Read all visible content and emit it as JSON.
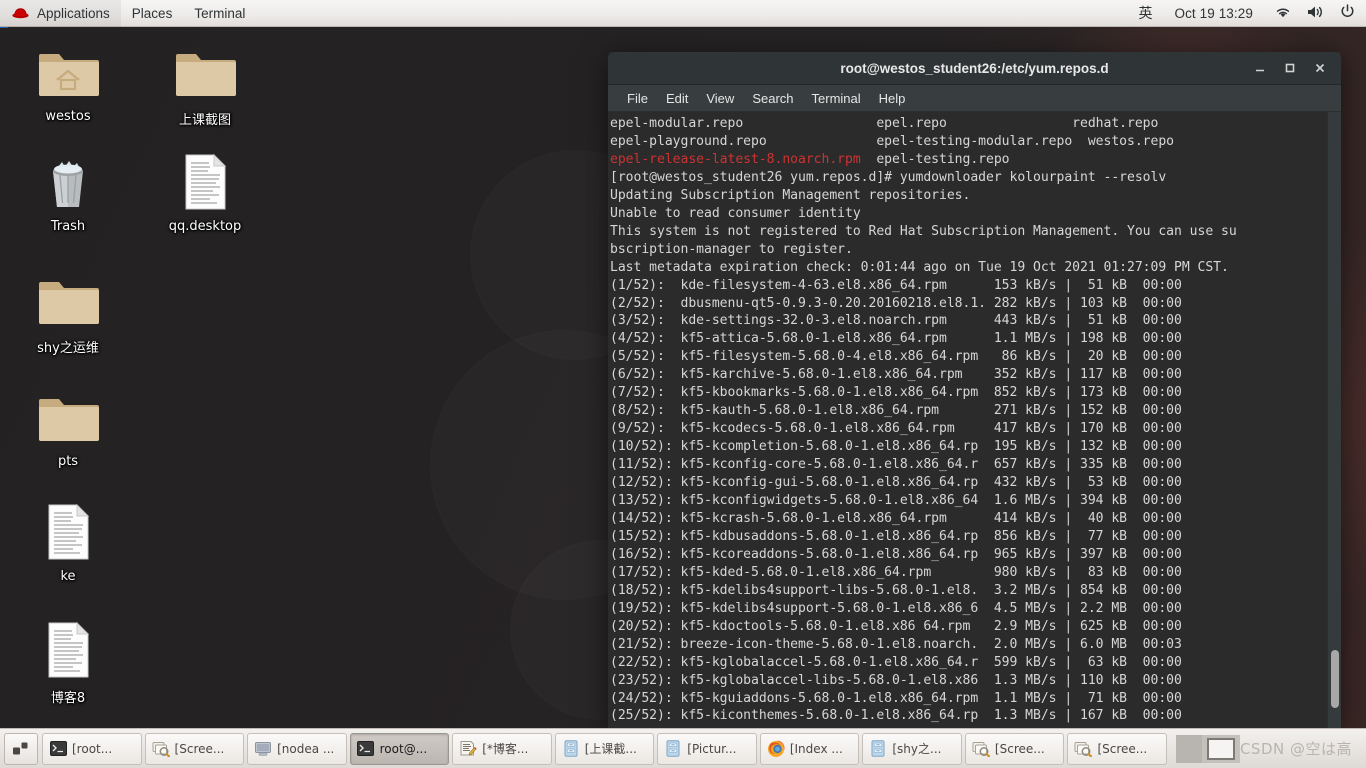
{
  "top_panel": {
    "logo_icon": "redhat-fedora-icon",
    "menus": [
      "Applications",
      "Places",
      "Terminal"
    ],
    "ime_label": "英",
    "clock": "Oct 19  13:29",
    "tray_icons": [
      "network-wifi-icon",
      "volume-icon",
      "power-icon"
    ]
  },
  "desktop": {
    "icons": [
      {
        "label": "westos",
        "icon": "home-folder-icon",
        "type": "folder-home"
      },
      {
        "label": "上课截图",
        "icon": "folder-icon",
        "type": "folder"
      },
      {
        "label": "Trash",
        "icon": "trash-icon",
        "type": "trash"
      },
      {
        "label": "qq.desktop",
        "icon": "text-document-icon",
        "type": "document"
      },
      {
        "label": "shy之运维",
        "icon": "folder-icon",
        "type": "folder"
      },
      {
        "label": "pts",
        "icon": "folder-icon",
        "type": "folder"
      },
      {
        "label": "ke",
        "icon": "text-document-icon",
        "type": "document"
      },
      {
        "label": "博客8",
        "icon": "text-document-icon",
        "type": "document"
      }
    ]
  },
  "terminal": {
    "title": "root@westos_student26:/etc/yum.repos.d",
    "menubar": [
      "File",
      "Edit",
      "View",
      "Search",
      "Terminal",
      "Help"
    ],
    "window_controls": {
      "minimize": "_",
      "maximize": "□",
      "close": "✕"
    },
    "repo_listing_line1": "epel-modular.repo                 epel.repo                redhat.repo",
    "repo_listing_line2": "epel-playground.repo              epel-testing-modular.repo  westos.repo",
    "repo_listing_line3_red": "epel-release-latest-8.noarch.rpm",
    "repo_listing_line3_rest": "  epel-testing.repo",
    "prompt_line": "[root@westos_student26 yum.repos.d]# yumdownloader kolourpaint --resolv",
    "status_lines": [
      "Updating Subscription Management repositories.",
      "Unable to read consumer identity",
      "This system is not registered to Red Hat Subscription Management. You can use su",
      "bscription-manager to register.",
      "Last metadata expiration check: 0:01:44 ago on Tue 19 Oct 2021 01:27:09 PM CST."
    ],
    "downloads": [
      {
        "n": "(1/52):",
        "pkg": "kde-filesystem-4-63.el8.x86_64.rpm",
        "rate": "153 kB/s",
        "size": " 51 kB",
        "time": "00:00"
      },
      {
        "n": "(2/52):",
        "pkg": "dbusmenu-qt5-0.9.3-0.20.20160218.el8.1.",
        "rate": "282 kB/s",
        "size": "103 kB",
        "time": "00:00"
      },
      {
        "n": "(3/52):",
        "pkg": "kde-settings-32.0-3.el8.noarch.rpm",
        "rate": "443 kB/s",
        "size": " 51 kB",
        "time": "00:00"
      },
      {
        "n": "(4/52):",
        "pkg": "kf5-attica-5.68.0-1.el8.x86_64.rpm",
        "rate": "1.1 MB/s",
        "size": "198 kB",
        "time": "00:00"
      },
      {
        "n": "(5/52):",
        "pkg": "kf5-filesystem-5.68.0-4.el8.x86_64.rpm",
        "rate": " 86 kB/s",
        "size": " 20 kB",
        "time": "00:00"
      },
      {
        "n": "(6/52):",
        "pkg": "kf5-karchive-5.68.0-1.el8.x86_64.rpm",
        "rate": "352 kB/s",
        "size": "117 kB",
        "time": "00:00"
      },
      {
        "n": "(7/52):",
        "pkg": "kf5-kbookmarks-5.68.0-1.el8.x86_64.rpm",
        "rate": "852 kB/s",
        "size": "173 kB",
        "time": "00:00"
      },
      {
        "n": "(8/52):",
        "pkg": "kf5-kauth-5.68.0-1.el8.x86_64.rpm",
        "rate": "271 kB/s",
        "size": "152 kB",
        "time": "00:00"
      },
      {
        "n": "(9/52):",
        "pkg": "kf5-kcodecs-5.68.0-1.el8.x86_64.rpm",
        "rate": "417 kB/s",
        "size": "170 kB",
        "time": "00:00"
      },
      {
        "n": "(10/52):",
        "pkg": "kf5-kcompletion-5.68.0-1.el8.x86_64.rp",
        "rate": "195 kB/s",
        "size": "132 kB",
        "time": "00:00"
      },
      {
        "n": "(11/52):",
        "pkg": "kf5-kconfig-core-5.68.0-1.el8.x86_64.r",
        "rate": "657 kB/s",
        "size": "335 kB",
        "time": "00:00"
      },
      {
        "n": "(12/52):",
        "pkg": "kf5-kconfig-gui-5.68.0-1.el8.x86_64.rp",
        "rate": "432 kB/s",
        "size": " 53 kB",
        "time": "00:00"
      },
      {
        "n": "(13/52):",
        "pkg": "kf5-kconfigwidgets-5.68.0-1.el8.x86_64",
        "rate": "1.6 MB/s",
        "size": "394 kB",
        "time": "00:00"
      },
      {
        "n": "(14/52):",
        "pkg": "kf5-kcrash-5.68.0-1.el8.x86_64.rpm",
        "rate": "414 kB/s",
        "size": " 40 kB",
        "time": "00:00"
      },
      {
        "n": "(15/52):",
        "pkg": "kf5-kdbusaddons-5.68.0-1.el8.x86_64.rp",
        "rate": "856 kB/s",
        "size": " 77 kB",
        "time": "00:00"
      },
      {
        "n": "(16/52):",
        "pkg": "kf5-kcoreaddons-5.68.0-1.el8.x86_64.rp",
        "rate": "965 kB/s",
        "size": "397 kB",
        "time": "00:00"
      },
      {
        "n": "(17/52):",
        "pkg": "kf5-kded-5.68.0-1.el8.x86_64.rpm",
        "rate": "980 kB/s",
        "size": " 83 kB",
        "time": "00:00"
      },
      {
        "n": "(18/52):",
        "pkg": "kf5-kdelibs4support-libs-5.68.0-1.el8.",
        "rate": "3.2 MB/s",
        "size": "854 kB",
        "time": "00:00"
      },
      {
        "n": "(19/52):",
        "pkg": "kf5-kdelibs4support-5.68.0-1.el8.x86_6",
        "rate": "4.5 MB/s",
        "size": "2.2 MB",
        "time": "00:00"
      },
      {
        "n": "(20/52):",
        "pkg": "kf5-kdoctools-5.68.0-1.el8.x86 64.rpm",
        "rate": "2.9 MB/s",
        "size": "625 kB",
        "time": "00:00"
      },
      {
        "n": "(21/52):",
        "pkg": "breeze-icon-theme-5.68.0-1.el8.noarch.",
        "rate": "2.0 MB/s",
        "size": "6.0 MB",
        "time": "00:03"
      },
      {
        "n": "(22/52):",
        "pkg": "kf5-kglobalaccel-5.68.0-1.el8.x86_64.r",
        "rate": "599 kB/s",
        "size": " 63 kB",
        "time": "00:00"
      },
      {
        "n": "(23/52):",
        "pkg": "kf5-kglobalaccel-libs-5.68.0-1.el8.x86",
        "rate": "1.3 MB/s",
        "size": "110 kB",
        "time": "00:00"
      },
      {
        "n": "(24/52):",
        "pkg": "kf5-kguiaddons-5.68.0-1.el8.x86_64.rpm",
        "rate": "1.1 MB/s",
        "size": " 71 kB",
        "time": "00:00"
      },
      {
        "n": "(25/52):",
        "pkg": "kf5-kiconthemes-5.68.0-1.el8.x86_64.rp",
        "rate": "1.3 MB/s",
        "size": "167 kB",
        "time": "00:00"
      }
    ]
  },
  "taskbar": {
    "show_desktop_icon": "show-desktop-icon",
    "buttons": [
      {
        "label": "[root...",
        "icon": "terminal-icon",
        "active": false
      },
      {
        "label": "[Scree...",
        "icon": "screenshot-icon",
        "active": false
      },
      {
        "label": "[nodea ...",
        "icon": "display-icon",
        "active": false
      },
      {
        "label": "root@...",
        "icon": "terminal-icon",
        "active": true
      },
      {
        "label": "[*博客...",
        "icon": "text-editor-icon",
        "active": false
      },
      {
        "label": "[上课截...",
        "icon": "file-manager-icon",
        "active": false
      },
      {
        "label": "[Pictur...",
        "icon": "file-manager-icon",
        "active": false
      },
      {
        "label": "[Index ...",
        "icon": "firefox-icon",
        "active": false
      },
      {
        "label": "[shy之...",
        "icon": "file-manager-icon",
        "active": false
      },
      {
        "label": "[Scree...",
        "icon": "screenshot-icon",
        "active": false
      },
      {
        "label": "[Scree...",
        "icon": "screenshot-icon",
        "active": false
      }
    ],
    "workspaces": 2,
    "watermark": "CSDN @空は高"
  },
  "colors": {
    "panel_bg": "#efecea",
    "terminal_bg": "#2b2b2b",
    "terminal_titlebar": "#2f3436",
    "terminal_menubar": "#383d3f",
    "terminal_text": "#d6d6d6",
    "terminal_red": "#cc3333",
    "desktop_bg": "#262324",
    "accent_red": "#cc0000"
  }
}
